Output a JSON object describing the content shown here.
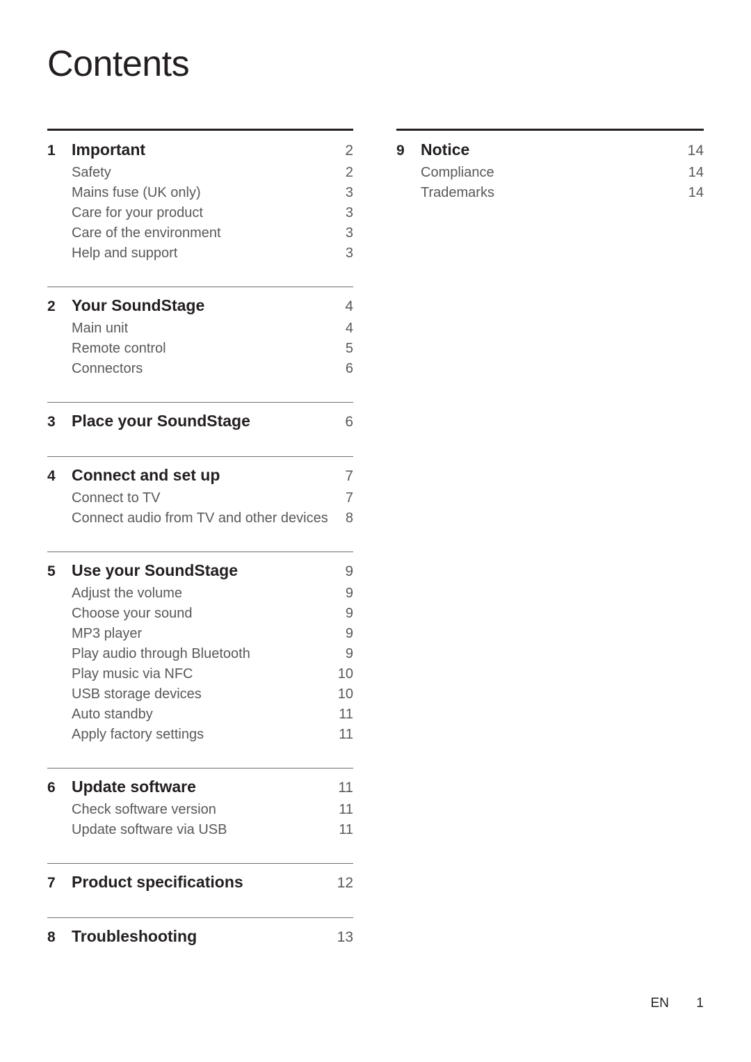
{
  "document": {
    "title": "Contents"
  },
  "footer": {
    "language": "EN",
    "page_number": "1"
  },
  "columns": {
    "left": [
      {
        "number": "1",
        "title": "Important",
        "page": "2",
        "items": [
          {
            "label": "Safety",
            "page": "2"
          },
          {
            "label": "Mains fuse (UK only)",
            "page": "3"
          },
          {
            "label": "Care for your product",
            "page": "3"
          },
          {
            "label": "Care of the environment",
            "page": "3"
          },
          {
            "label": "Help and support",
            "page": "3"
          }
        ]
      },
      {
        "number": "2",
        "title": "Your SoundStage",
        "page": "4",
        "items": [
          {
            "label": "Main unit",
            "page": "4"
          },
          {
            "label": "Remote control",
            "page": "5"
          },
          {
            "label": "Connectors",
            "page": "6"
          }
        ]
      },
      {
        "number": "3",
        "title": "Place your SoundStage",
        "page": "6",
        "items": []
      },
      {
        "number": "4",
        "title": "Connect and set up",
        "page": "7",
        "items": [
          {
            "label": "Connect to TV",
            "page": "7"
          },
          {
            "label": "Connect audio from TV and other devices",
            "page": "8",
            "tight": true
          }
        ]
      },
      {
        "number": "5",
        "title": "Use your SoundStage",
        "page": "9",
        "items": [
          {
            "label": "Adjust the volume",
            "page": "9"
          },
          {
            "label": "Choose your sound",
            "page": "9"
          },
          {
            "label": "MP3 player",
            "page": "9"
          },
          {
            "label": "Play audio through Bluetooth",
            "page": "9"
          },
          {
            "label": "Play music via NFC",
            "page": "10"
          },
          {
            "label": "USB storage devices",
            "page": "10"
          },
          {
            "label": "Auto standby",
            "page": "11"
          },
          {
            "label": "Apply factory settings",
            "page": "11"
          }
        ]
      },
      {
        "number": "6",
        "title": "Update software",
        "page": "11",
        "items": [
          {
            "label": "Check software version",
            "page": "11"
          },
          {
            "label": "Update software via USB",
            "page": "11"
          }
        ]
      },
      {
        "number": "7",
        "title": "Product specifications",
        "page": "12",
        "items": []
      },
      {
        "number": "8",
        "title": "Troubleshooting",
        "page": "13",
        "items": []
      }
    ],
    "right": [
      {
        "number": "9",
        "title": "Notice",
        "page": "14",
        "items": [
          {
            "label": "Compliance",
            "page": "14"
          },
          {
            "label": "Trademarks",
            "page": "14"
          }
        ]
      }
    ]
  }
}
